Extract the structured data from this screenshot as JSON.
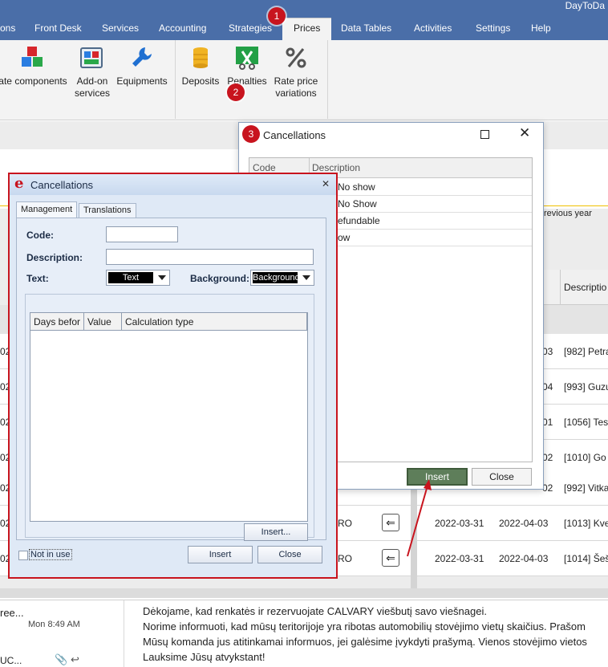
{
  "app": {
    "title": "DayToDa"
  },
  "menu": {
    "tabs": [
      "ons",
      "Front Desk",
      "Services",
      "Accounting",
      "Strategies",
      "Prices",
      "Data Tables",
      "Activities",
      "Settings",
      "Help"
    ],
    "active_tab": "Prices"
  },
  "ribbon": {
    "buttons": [
      {
        "label": "ate components",
        "icon": "components-icon"
      },
      {
        "label": "Add-on services",
        "icon": "addon-services-icon"
      },
      {
        "label": "Equipments",
        "icon": "wrench-icon"
      },
      {
        "label": "Deposits",
        "icon": "coins-icon"
      },
      {
        "label": "Penalties",
        "icon": "penalties-icon"
      },
      {
        "label": "Rate price variations",
        "icon": "percent-icon"
      }
    ]
  },
  "callouts": [
    "1",
    "2",
    "3"
  ],
  "list_window": {
    "title": "Cancellations",
    "columns": [
      "Code",
      "Description"
    ],
    "rows": [
      "No show",
      "No Show",
      "efundable",
      "ow"
    ],
    "insert_label": "Insert",
    "close_label": "Close"
  },
  "edit_dialog": {
    "title": "Cancellations",
    "tabs": [
      "Management",
      "Translations"
    ],
    "code_label": "Code:",
    "code_value": "",
    "description_label": "Description:",
    "description_value": "",
    "text_label": "Text:",
    "text_value": "Text",
    "background_label": "Background:",
    "background_value": "Background",
    "grid_columns": [
      "Days befor",
      "Value",
      "Calculation type"
    ],
    "grid_insert_label": "Insert...",
    "not_in_use_label": "Not in use",
    "insert_label": "Insert",
    "close_label": "Close"
  },
  "background": {
    "revious_year": "revious year",
    "description_header": "Descriptio",
    "rows": [
      {
        "left": "02",
        "mid": "03",
        "right": "[982] Petra"
      },
      {
        "left": "02",
        "mid": "04",
        "right": "[993] Guzu"
      },
      {
        "left": "02",
        "mid": "01",
        "right": "[1056] Tes"
      },
      {
        "left": "02",
        "mid": "02",
        "right": "[1010] Go"
      },
      {
        "left": "02",
        "mid": "02",
        "right": "[992] Vitka"
      },
      {
        "left": "02",
        "mid": "RO",
        "arrival": "2022-03-31",
        "departure": "2022-04-03",
        "right": "[1013] Kve"
      },
      {
        "left": "02",
        "mid": "RO",
        "arrival": "2022-03-31",
        "departure": "2022-04-03",
        "right": "[1014] Šeš"
      }
    ]
  },
  "mail": {
    "sender": "ree...",
    "sender_prefix": "UC...",
    "time": "Mon 8:49 AM",
    "body": [
      "Dėkojame, kad renkatės ir rezervuojate CALVARY viešbutį savo viešnagei.",
      "Norime informuoti, kad mūsų teritorijoje yra ribotas automobilių stovėjimo vietų skaičius. Prašom",
      "Mūsų komanda jus atitinkamai informuos, jei galėsime įvykdyti prašymą. Vienos stovėjimo vietos",
      "Lauksime Jūsų atvykstant!"
    ]
  }
}
